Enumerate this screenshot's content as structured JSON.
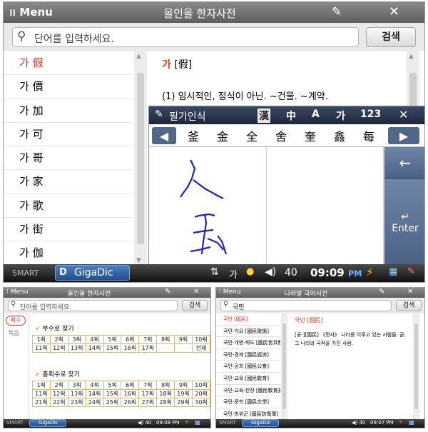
{
  "top": {
    "title": {
      "menu": "Menu",
      "app": "올인올 한자사전"
    },
    "search": {
      "placeholder": "단어를 입력하세요.",
      "button": "검색"
    },
    "list": [
      {
        "hanja": "가 假",
        "selected": true
      },
      {
        "hanja": "가 價"
      },
      {
        "hanja": "가 加"
      },
      {
        "hanja": "가 可"
      },
      {
        "hanja": "가 哥"
      },
      {
        "hanja": "가 家"
      },
      {
        "hanja": "가 歌"
      },
      {
        "hanja": "가 街"
      },
      {
        "hanja": "가 伽"
      }
    ],
    "entry": {
      "head_hangul": "가",
      "head_hanja": "[假]",
      "definition": "(1) 임시적인, 정식이 아닌. ~건물. ~계약."
    },
    "ime": {
      "title": "필기인식",
      "modes": [
        "漢",
        "中",
        "A",
        "가",
        "123"
      ],
      "candidates": [
        "釜",
        "金",
        "全",
        "舍",
        "奎",
        "鑫",
        "每"
      ],
      "enter": "Enter",
      "back": "←"
    },
    "taskbar": {
      "smart": "SMART",
      "app": "GigaDic",
      "ime": "가",
      "volume": "40",
      "time": "09:09",
      "ampm": "PM"
    }
  },
  "bottom_left": {
    "title": {
      "menu": "Menu",
      "app": "올인올 한자사전"
    },
    "search": {
      "placeholder": "단어를 입력하세요.",
      "button": "검색"
    },
    "sidebar": [
      "획수",
      "독음"
    ],
    "section1": "부수로 찾기",
    "radical_rows": [
      [
        "1획",
        "2획",
        "3획",
        "4획",
        "5획",
        "6획",
        "7획",
        "8획",
        "9획",
        "10획"
      ],
      [
        "11획",
        "12획",
        "13획",
        "14획",
        "15획",
        "16획",
        "17획",
        "",
        "",
        "전체"
      ]
    ],
    "section2": "총획수로 찾기",
    "total_rows": [
      [
        "1획",
        "2획",
        "3획",
        "4획",
        "5획",
        "6획",
        "7획",
        "8획",
        "9획",
        "10획"
      ],
      [
        "11획",
        "12획",
        "13획",
        "14획",
        "15획",
        "16획",
        "17획",
        "18획",
        "19획",
        "20획"
      ],
      [
        "21획",
        "22획",
        "23획",
        "24획",
        "25획",
        "26획",
        "27획",
        "28획",
        "29획",
        "30획"
      ]
    ],
    "taskbar": {
      "smart": "SMART",
      "app": "GigaDic",
      "volume": "40",
      "time": "09:08 PM"
    }
  },
  "bottom_right": {
    "title": {
      "menu": "Menu",
      "app": "나라말 국어사전"
    },
    "search": {
      "value": "국민",
      "button": "검색"
    },
    "list": [
      "국민 [國民]",
      "국민-가요 [國民歌謠]",
      "국민-개병-제도 [國民皆兵制度]",
      "국민-경제 [國民經濟]",
      "국민-공회 [國民公會]",
      "국민-교육 [國民敎育]",
      "국민-교육-헌장 [國民敎育憲章]",
      "국민-문학 [國民文學]",
      "국민-방위군 [國民防衛軍]"
    ],
    "entry": {
      "head": "국민 [國民]",
      "body": "[궁-][國民] 《명사》 나라를 이루고 있는 사람들. 곧, 그 나라의 국적을 가진 사람."
    },
    "taskbar": {
      "smart": "SMART",
      "app": "GigaDic",
      "volume": "40",
      "time": "09:07 PM"
    }
  },
  "colors": {
    "accent_red": "#e03a1e",
    "taskbar": "#1e1e1e",
    "ime_bar": "#2a3550",
    "grid_border": "#e7b46a"
  }
}
